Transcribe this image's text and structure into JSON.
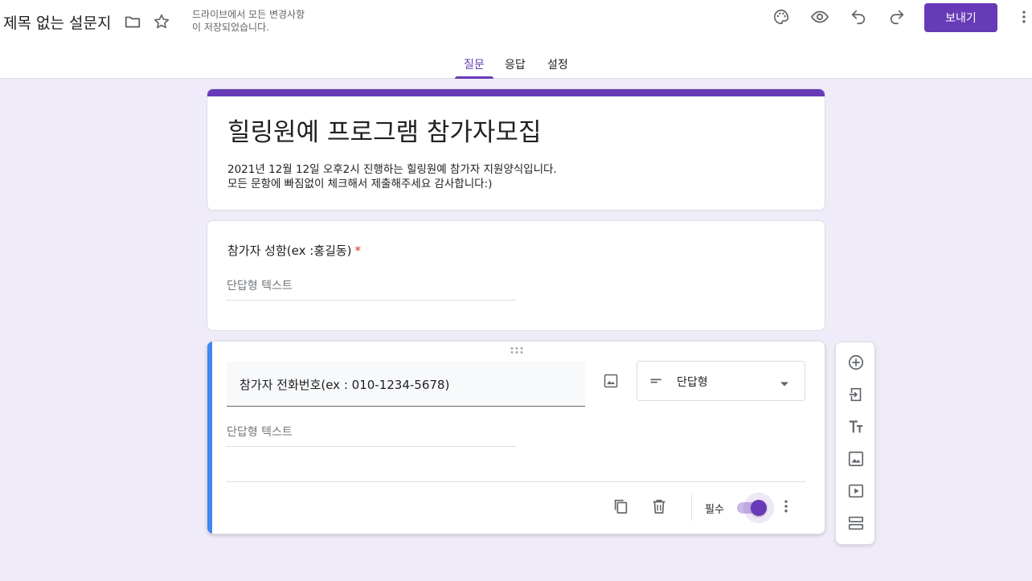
{
  "header": {
    "doc_title": "제목 없는 설문지",
    "save_status_line1": "드라이브에서 모든 변경사항",
    "save_status_line2": "이 저장되었습니다.",
    "send_label": "보내기",
    "icons": [
      "folder-icon",
      "star-icon",
      "palette-icon",
      "eye-icon",
      "undo-icon",
      "redo-icon",
      "more-vert-icon"
    ]
  },
  "tabs": [
    {
      "label": "질문",
      "active": true
    },
    {
      "label": "응답",
      "active": false
    },
    {
      "label": "설정",
      "active": false
    }
  ],
  "form": {
    "title": "힐링원예 프로그램 참가자모집",
    "description_line1": "2021년 12월 12일 오후2시 진행하는 힐링원예 참가자 지원양식입니다.",
    "description_line2": "모든 문항에 빠짐없이 체크해서 제출해주세요 감사합니다:)"
  },
  "questions": [
    {
      "title": "참가자 성함(ex :홍길동)",
      "required_mark": "*",
      "answer_placeholder": "단답형 텍스트"
    },
    {
      "title": "참가자 전화번호(ex : 010-1234-5678)",
      "answer_placeholder": "단답형 텍스트",
      "type_label": "단답형",
      "required_label": "필수",
      "required_on": true
    }
  ],
  "side_toolbar": [
    "add-question-icon",
    "import-questions-icon",
    "add-title-icon",
    "add-image-icon",
    "add-video-icon",
    "add-section-icon"
  ],
  "colors": {
    "accent": "#673ab7",
    "background": "#f0ebf8",
    "active_indicator": "#4285f4",
    "required": "#d93025"
  }
}
